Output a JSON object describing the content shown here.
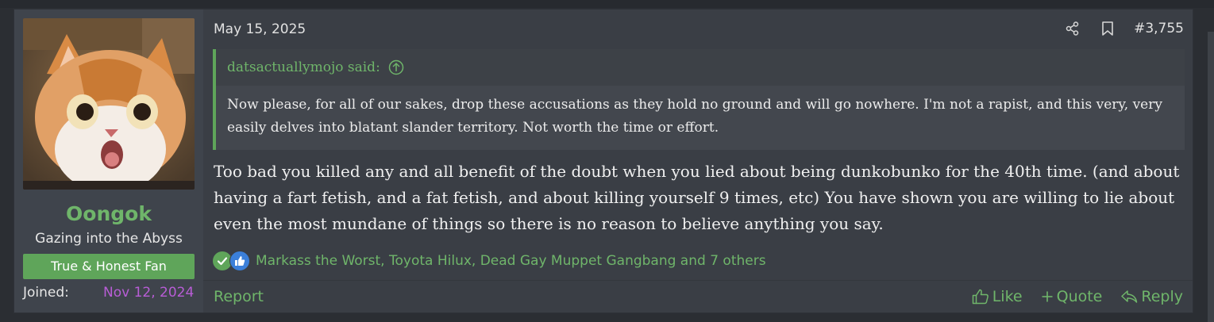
{
  "user": {
    "avatar_icon": "cat-avatar",
    "name": "Oongok",
    "title": "Gazing into the Abyss",
    "banner": "True & Honest Fan",
    "joined_label": "Joined:",
    "joined_date": "Nov 12, 2024"
  },
  "post": {
    "date": "May 15, 2025",
    "number": "#3,755",
    "share_icon": "share-icon",
    "bookmark_icon": "bookmark-icon",
    "quote": {
      "author": "datsactuallymojo said:",
      "text": "Now please, for all of our sakes, drop these accusations as they hold no ground and will go nowhere. I'm not a rapist, and this very, very easily delves into blatant slander territory. Not worth the time or effort."
    },
    "message": "Too bad you killed any and all benefit of the doubt when you lied about being dunkobunko for the 40th time. (and about having a fart fetish, and a fat fetish, and about killing yourself 9 times, etc) You have shown you are willing to lie about even the most mundane of things so there is no reason to believe anything you say.",
    "reactions": {
      "icons": [
        "check-reaction-icon",
        "like-reaction-icon"
      ],
      "names": "Markass the Worst, Toyota Hilux, Dead Gay Muppet Gangbang and 7 others"
    },
    "footer": {
      "report": "Report",
      "like": "Like",
      "quote": "Quote",
      "reply": "Reply"
    }
  },
  "colors": {
    "accent_green": "#6fb56a",
    "banner_green": "#5fa55a",
    "join_date_purple": "#b85dd6",
    "post_bg": "#3a3e45"
  }
}
